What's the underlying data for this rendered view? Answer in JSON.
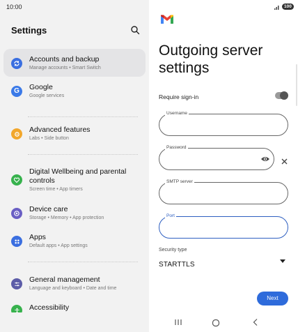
{
  "status_bar": {
    "time": "10:00",
    "battery": "100"
  },
  "settings": {
    "title": "Settings",
    "items": [
      {
        "title": "Accounts and backup",
        "subtitle": "Manage accounts • Smart Switch",
        "icon": "sync-icon",
        "color": "#3b6fe0"
      },
      {
        "title": "Google",
        "subtitle": "Google services",
        "icon": "google-icon",
        "color": "#3b7ae8"
      },
      {
        "title": "Advanced features",
        "subtitle": "Labs • Side button",
        "icon": "star-gear-icon",
        "color": "#f2a72c"
      },
      {
        "title": "Digital Wellbeing and parental controls",
        "subtitle": "Screen time • App timers",
        "icon": "wellbeing-icon",
        "color": "#37b24d"
      },
      {
        "title": "Device care",
        "subtitle": "Storage • Memory • App protection",
        "icon": "device-care-icon",
        "color": "#6a5fc4"
      },
      {
        "title": "Apps",
        "subtitle": "Default apps • App settings",
        "icon": "apps-icon",
        "color": "#3b6fe0"
      },
      {
        "title": "General management",
        "subtitle": "Language and keyboard • Date and time",
        "icon": "sliders-icon",
        "color": "#5c5ca8"
      },
      {
        "title": "Accessibility",
        "subtitle": "",
        "icon": "accessibility-icon",
        "color": "#37b24d"
      }
    ]
  },
  "gmail": {
    "page_title": "Outgoing server settings",
    "require_signin": {
      "label": "Require sign-in",
      "on": true
    },
    "fields": {
      "username": {
        "label": "Username",
        "value": ""
      },
      "password": {
        "label": "Password",
        "value": ""
      },
      "smtp_server": {
        "label": "SMTP server",
        "value": ""
      },
      "port": {
        "label": "Port",
        "value": ""
      }
    },
    "security_type": {
      "label": "Security type",
      "value": "STARTTLS"
    },
    "next_label": "Next"
  },
  "colors": {
    "accent": "#2e6bdb",
    "focus": "#2e5fc1"
  }
}
